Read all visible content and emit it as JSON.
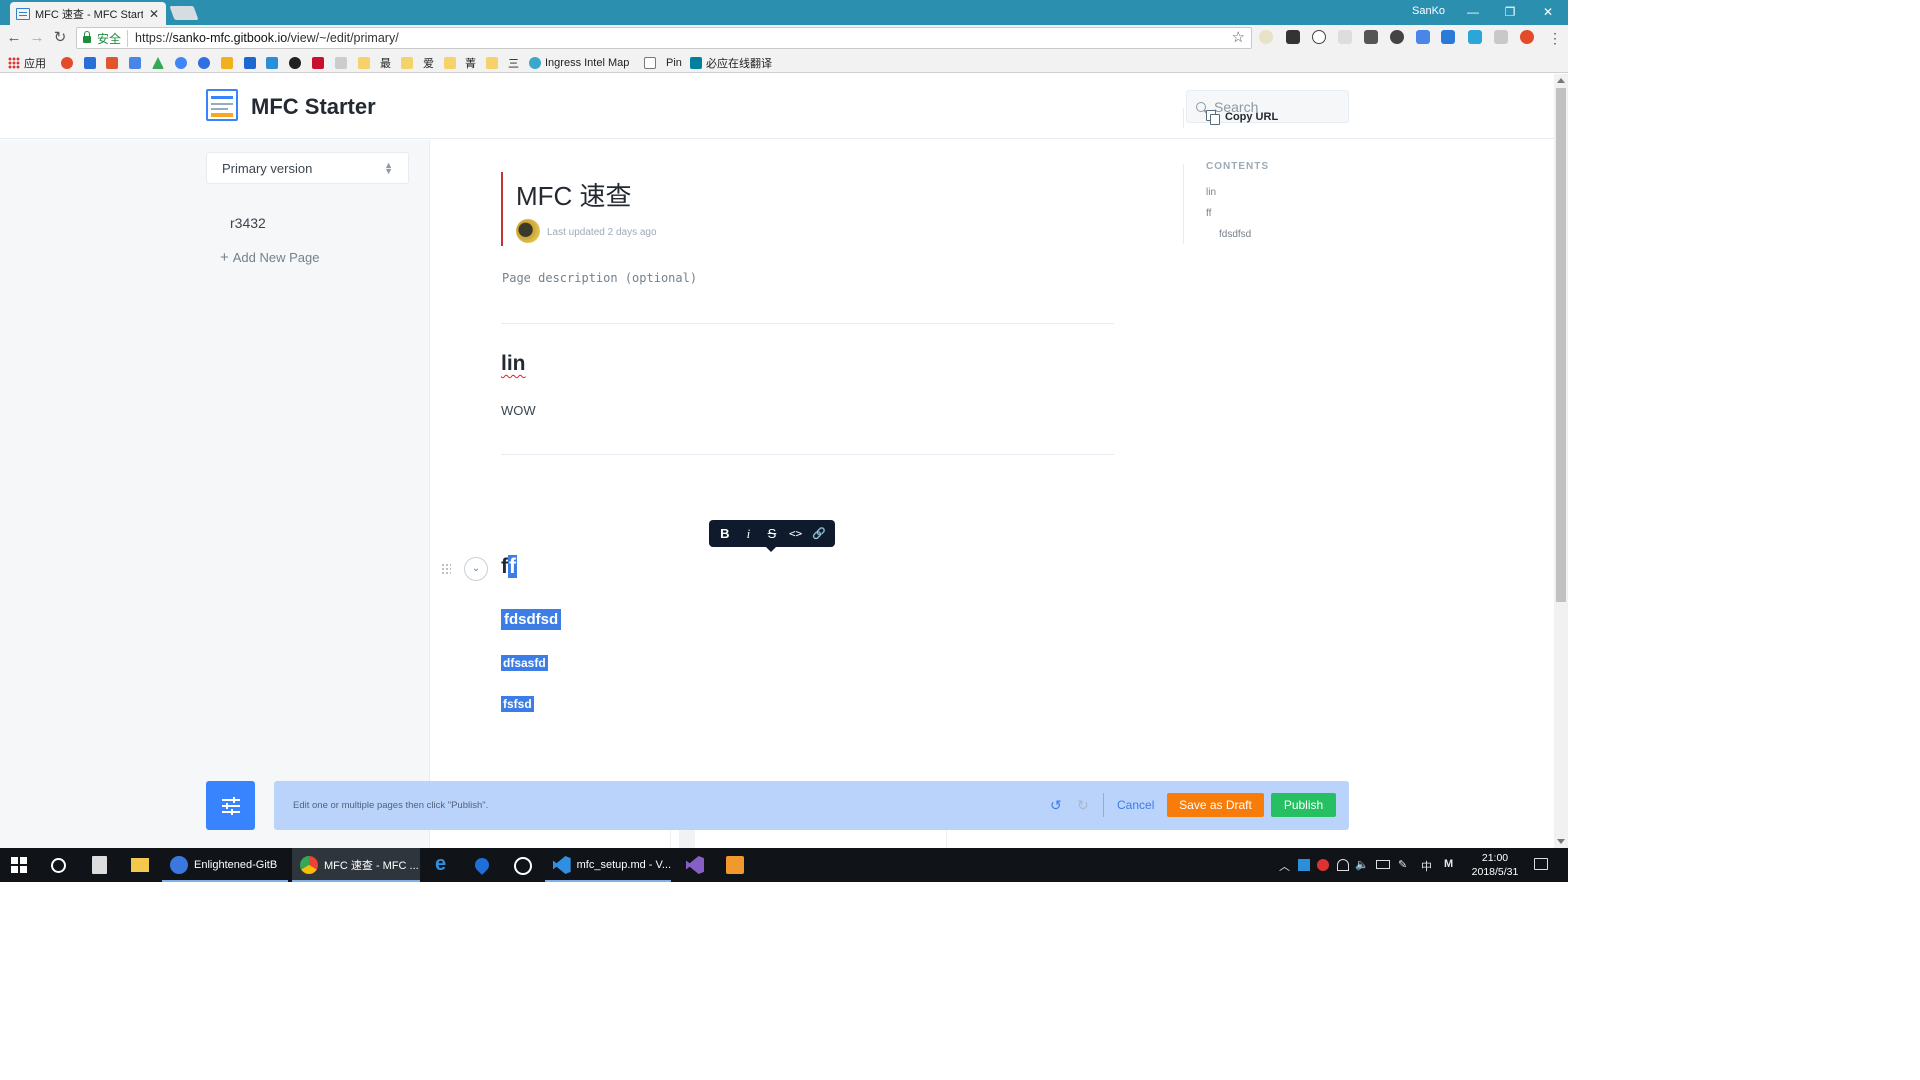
{
  "browser": {
    "tab_title": "MFC 速查 - MFC Starter",
    "tab_close": "✕",
    "user_name": "SanKo",
    "window_controls": {
      "minimize": "—",
      "maximize": "❐",
      "close": "✕"
    },
    "nav": {
      "back": "←",
      "forward": "→",
      "reload": "↻"
    },
    "secure_label": "安全",
    "url_prefix": "https://",
    "url_host": "sanko-mfc.gitbook.io",
    "url_path": "/view/~/edit/primary/",
    "star": "☆",
    "menu": "⋮",
    "bookmarks": {
      "apps": "应用",
      "b_zui": "最",
      "b_ai": "爱",
      "b_jing": "菁",
      "b_san": "三",
      "ingress": "Ingress Intel Map",
      "pin": "Pin",
      "translate": "必应在线翻译"
    }
  },
  "site": {
    "title": "MFC Starter",
    "search_placeholder": "Search"
  },
  "sidebar": {
    "version_label": "Primary version",
    "pages": [
      "r3432"
    ],
    "add_page_label": "Add New Page"
  },
  "document": {
    "title": "MFC 速查",
    "last_updated": "Last updated 2 days ago",
    "description_placeholder": "Page description (optional)",
    "heading_1": "lin",
    "paragraph_1": "WOW",
    "heading_2_plain": "f",
    "heading_2_selected": "f",
    "selected_lines": [
      "fdsdfsd",
      "dfsasfd",
      "fsfsd"
    ]
  },
  "format_toolbar": {
    "bold": "B",
    "italic": "i",
    "strike": "S",
    "code": "<>",
    "link": "🔗"
  },
  "toc": {
    "copy_url": "Copy URL",
    "heading": "CONTENTS",
    "items": [
      "lin",
      "ff",
      "fdsdfsd"
    ]
  },
  "edit_bar": {
    "hint": "Edit one or multiple pages then click \"Publish\".",
    "undo": "↺",
    "redo": "↻",
    "cancel": "Cancel",
    "save_draft": "Save as Draft",
    "publish": "Publish"
  },
  "taskbar": {
    "items": [
      {
        "label": "Enlightened-GitB"
      },
      {
        "label": "MFC 速查 - MFC ..."
      },
      {
        "label": "mfc_setup.md - V..."
      }
    ],
    "ime": "中",
    "ime_mode": "M",
    "time": "21:00",
    "date": "2018/5/31"
  },
  "colors": {
    "accent_blue": "#3884ff",
    "draft_orange": "#f77c0a",
    "publish_green": "#26c062",
    "title_bar_red": "#c13535",
    "selection_blue": "#3d7de6"
  }
}
